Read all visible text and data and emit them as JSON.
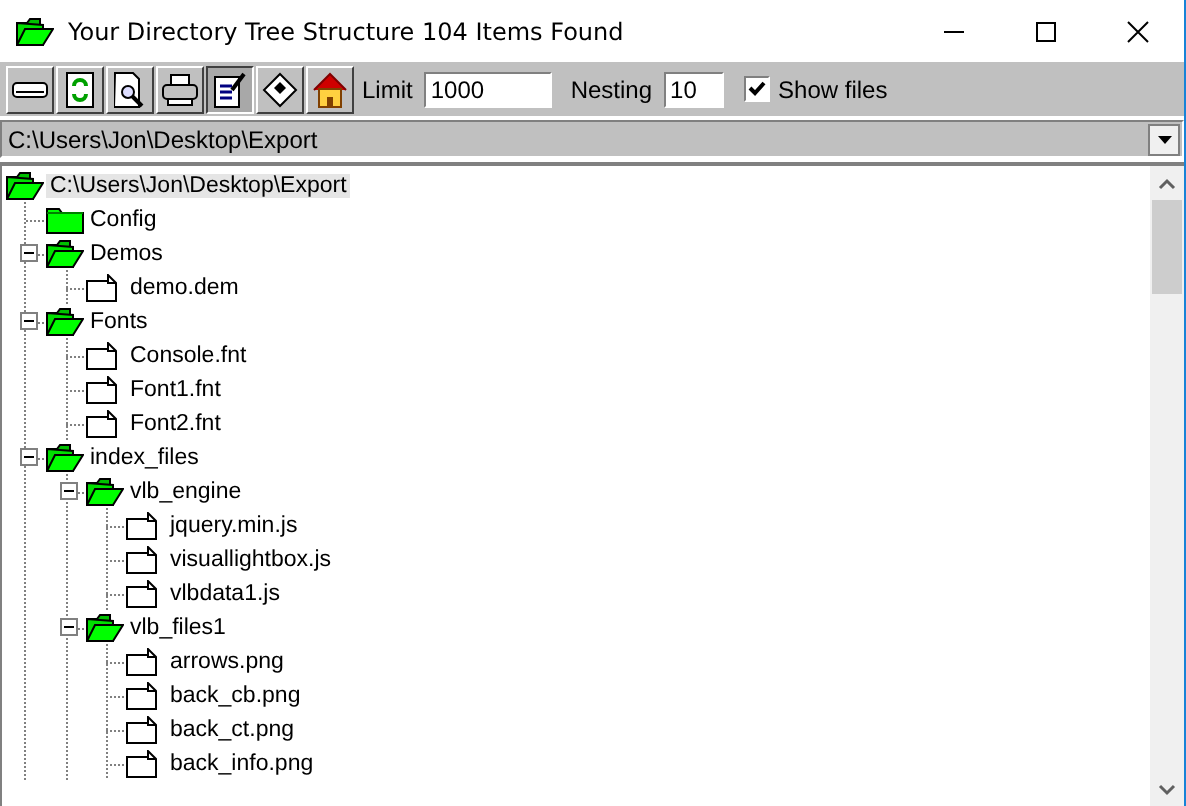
{
  "window": {
    "title": "Your Directory Tree Structure 104 Items Found"
  },
  "toolbar": {
    "buttons": [
      {
        "kind": "drive",
        "pressed": false
      },
      {
        "kind": "refresh",
        "pressed": false
      },
      {
        "kind": "preview",
        "pressed": false
      },
      {
        "kind": "print",
        "pressed": false
      },
      {
        "kind": "edit",
        "pressed": true
      },
      {
        "kind": "diskette",
        "pressed": false
      },
      {
        "kind": "home",
        "pressed": false
      }
    ],
    "limit": {
      "label": "Limit",
      "value": "1000"
    },
    "nesting": {
      "label": "Nesting",
      "value": "10"
    },
    "show_files": {
      "label": "Show files",
      "checked": true
    }
  },
  "path_combo": {
    "value": "C:\\Users\\Jon\\Desktop\\Export"
  },
  "tree": [
    {
      "label": "C:\\Users\\Jon\\Desktop\\Export",
      "kind": "folder",
      "selected": true,
      "children": [
        {
          "label": "Config",
          "kind": "folder",
          "selected": false
        },
        {
          "label": "Demos",
          "kind": "folder",
          "selected": false,
          "expanded": true,
          "children": [
            {
              "label": "demo.dem",
              "kind": "file",
              "selected": false
            }
          ]
        },
        {
          "label": "Fonts",
          "kind": "folder",
          "selected": false,
          "expanded": true,
          "children": [
            {
              "label": "Console.fnt",
              "kind": "file",
              "selected": false
            },
            {
              "label": "Font1.fnt",
              "kind": "file",
              "selected": false
            },
            {
              "label": "Font2.fnt",
              "kind": "file",
              "selected": false
            }
          ]
        },
        {
          "label": "index_files",
          "kind": "folder",
          "selected": false,
          "expanded": true,
          "children": [
            {
              "label": "vlb_engine",
              "kind": "folder",
              "selected": false,
              "expanded": true,
              "children": [
                {
                  "label": "jquery.min.js",
                  "kind": "file",
                  "selected": false
                },
                {
                  "label": "visuallightbox.js",
                  "kind": "file",
                  "selected": false
                },
                {
                  "label": "vlbdata1.js",
                  "kind": "file",
                  "selected": false
                }
              ]
            },
            {
              "label": "vlb_files1",
              "kind": "folder",
              "selected": false,
              "expanded": true,
              "children": [
                {
                  "label": "arrows.png",
                  "kind": "file",
                  "selected": false
                },
                {
                  "label": "back_cb.png",
                  "kind": "file",
                  "selected": false
                },
                {
                  "label": "back_ct.png",
                  "kind": "file",
                  "selected": false
                },
                {
                  "label": "back_info.png",
                  "kind": "file",
                  "selected": false
                }
              ]
            }
          ]
        }
      ]
    }
  ]
}
